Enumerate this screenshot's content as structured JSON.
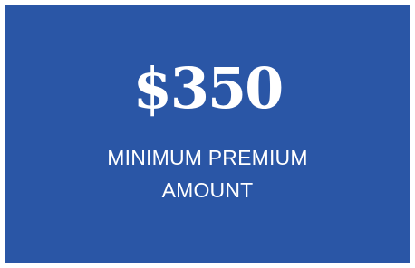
{
  "card": {
    "amount": "$350",
    "label_line1": "MINIMUM PREMIUM",
    "label_line2": "AMOUNT",
    "background_color": "#2a56a6",
    "text_color": "#ffffff"
  }
}
